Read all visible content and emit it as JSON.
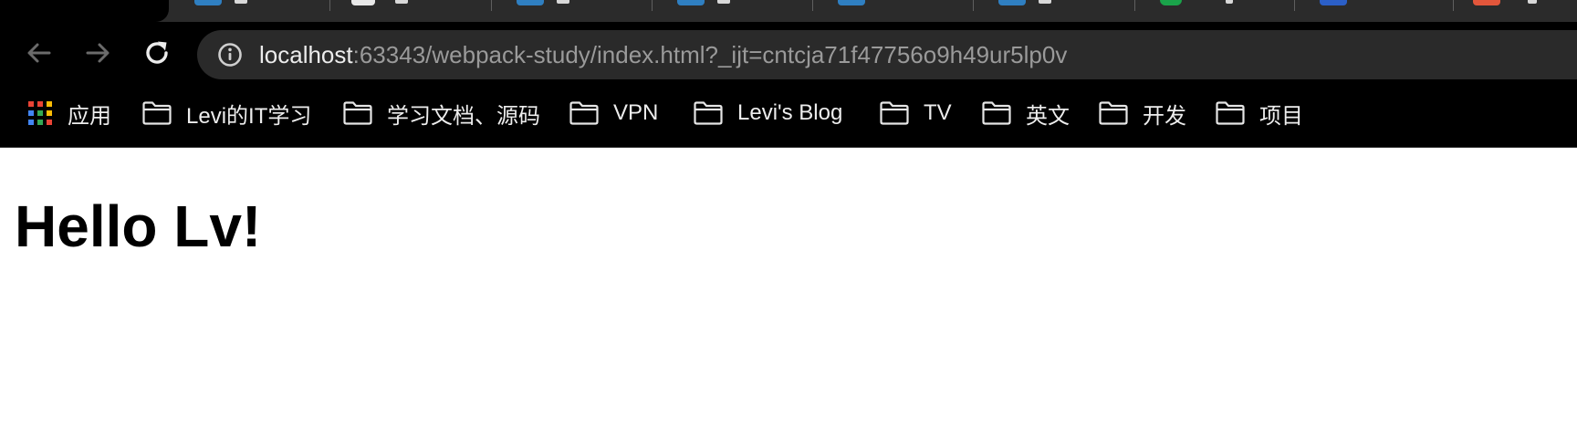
{
  "colors": {
    "chrome_bg": "#000000",
    "tab_strip_bg": "#2b2b2b",
    "omnibox_bg": "#2a2a2a",
    "url_host": "#ececec",
    "url_rest": "#9a9a9a",
    "bookmark_text": "#ededed",
    "page_bg": "#ffffff",
    "page_text": "#000000"
  },
  "tabs": [
    {
      "icon": "tab-favicon-icon",
      "color": "#2f7fc1"
    },
    {
      "icon": "tab-favicon-icon",
      "color": "#e8e8e8"
    },
    {
      "icon": "tab-favicon-icon",
      "color": "#2f7fc1"
    },
    {
      "icon": "tab-favicon-icon",
      "color": "#2f7fc1"
    },
    {
      "icon": "tab-favicon-icon",
      "color": "#2f7fc1"
    },
    {
      "icon": "tab-favicon-icon",
      "color": "#2f7fc1"
    },
    {
      "icon": "tab-favicon-icon",
      "color": "#1aa34a"
    },
    {
      "icon": "tab-favicon-icon",
      "color": "#2b5fc7"
    },
    {
      "icon": "tab-favicon-icon",
      "color": "#e2563b"
    }
  ],
  "toolbar": {
    "back_icon": "arrow-left-icon",
    "forward_icon": "arrow-right-icon",
    "reload_icon": "reload-icon",
    "site_info_icon": "info-icon",
    "url_host": "localhost",
    "url_rest": ":63343/webpack-study/index.html?_ijt=cntcja71f47756o9h49ur5lp0v"
  },
  "bookmarks": {
    "apps_label": "应用",
    "apps_icon": "apps-grid-icon",
    "folder_icon": "folder-icon",
    "items": [
      {
        "label": "Levi的IT学习"
      },
      {
        "label": "学习文档、源码"
      },
      {
        "label": "VPN"
      },
      {
        "label": "Levi's Blog"
      },
      {
        "label": "TV"
      },
      {
        "label": "英文"
      },
      {
        "label": "开发"
      },
      {
        "label": "项目"
      }
    ]
  },
  "page": {
    "heading": "Hello Lv!"
  }
}
